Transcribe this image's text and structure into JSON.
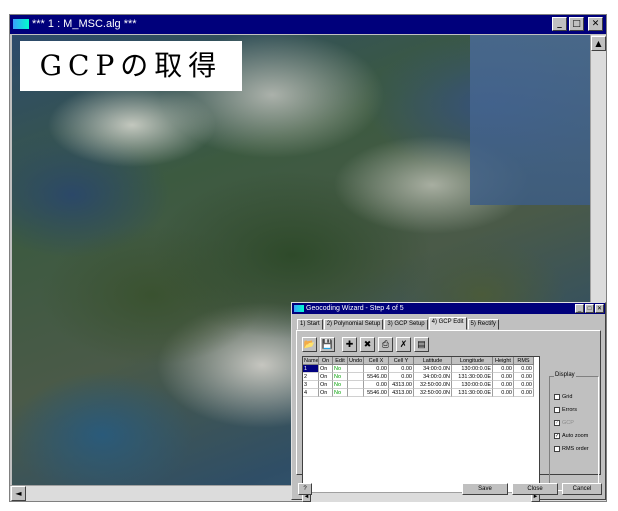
{
  "main_window": {
    "title": "*** 1 : M_MSC.alg ***",
    "controls": {
      "minimize": "_",
      "maximize": "□",
      "close": "✕"
    }
  },
  "banner": {
    "text": "GCPの取得"
  },
  "scrollbars": {
    "up": "▲",
    "left": "◄",
    "right": "►",
    "down": "▼"
  },
  "wizard": {
    "title": "Geocoding Wizard - Step 4 of 5",
    "controls": {
      "minimize": "_",
      "maximize": "□",
      "close": "✕"
    },
    "tabs": [
      {
        "label": "1) Start"
      },
      {
        "label": "2) Polynomial Setup"
      },
      {
        "label": "3) GCP Setup"
      },
      {
        "label": "4) GCP Edit",
        "active": true
      },
      {
        "label": "5) Rectify"
      }
    ],
    "toolbar": [
      {
        "icon": "open-folder-icon",
        "glyph": "📂"
      },
      {
        "icon": "save-disk-icon",
        "glyph": "💾"
      },
      {
        "icon": "add-point-icon",
        "glyph": "✚"
      },
      {
        "icon": "delete-point-icon",
        "glyph": "✖"
      },
      {
        "icon": "print-icon",
        "glyph": "⎙"
      },
      {
        "icon": "clear-icon",
        "glyph": "✗"
      },
      {
        "icon": "list-icon",
        "glyph": "▤"
      }
    ],
    "table": {
      "columns": [
        "Name",
        "On",
        "Edit",
        "Undo",
        "Cell X",
        "Cell Y",
        "Latitude",
        "Longitude",
        "Height",
        "RMS"
      ],
      "rows": [
        [
          "1",
          "On",
          "No",
          "",
          "0.00",
          "0.00",
          "34:00:0.0N",
          "130:00:0.0E",
          "0.00",
          "0.00"
        ],
        [
          "2",
          "On",
          "No",
          "",
          "5546.00",
          "0.00",
          "34:00:0.0N",
          "131:30:00.0E",
          "0.00",
          "0.00"
        ],
        [
          "3",
          "On",
          "No",
          "",
          "0.00",
          "4313.00",
          "32:50:00.0N",
          "130:00:0.0E",
          "0.00",
          "0.00"
        ],
        [
          "4",
          "On",
          "No",
          "",
          "5546.00",
          "4313.00",
          "32:50:00.0N",
          "131:30:00.0E",
          "0.00",
          "0.00"
        ]
      ]
    },
    "display": {
      "legend": "Display",
      "options": [
        {
          "label": "Grid",
          "checked": false,
          "enabled": true
        },
        {
          "label": "Errors",
          "checked": false,
          "enabled": true
        },
        {
          "label": "GCP",
          "checked": true,
          "enabled": false
        },
        {
          "label": "Auto zoom",
          "checked": true,
          "enabled": true
        },
        {
          "label": "RMS order",
          "checked": false,
          "enabled": true
        }
      ]
    },
    "buttons": {
      "save": "Save",
      "close": "Close",
      "cancel": "Cancel",
      "help_glyph": "?"
    }
  }
}
